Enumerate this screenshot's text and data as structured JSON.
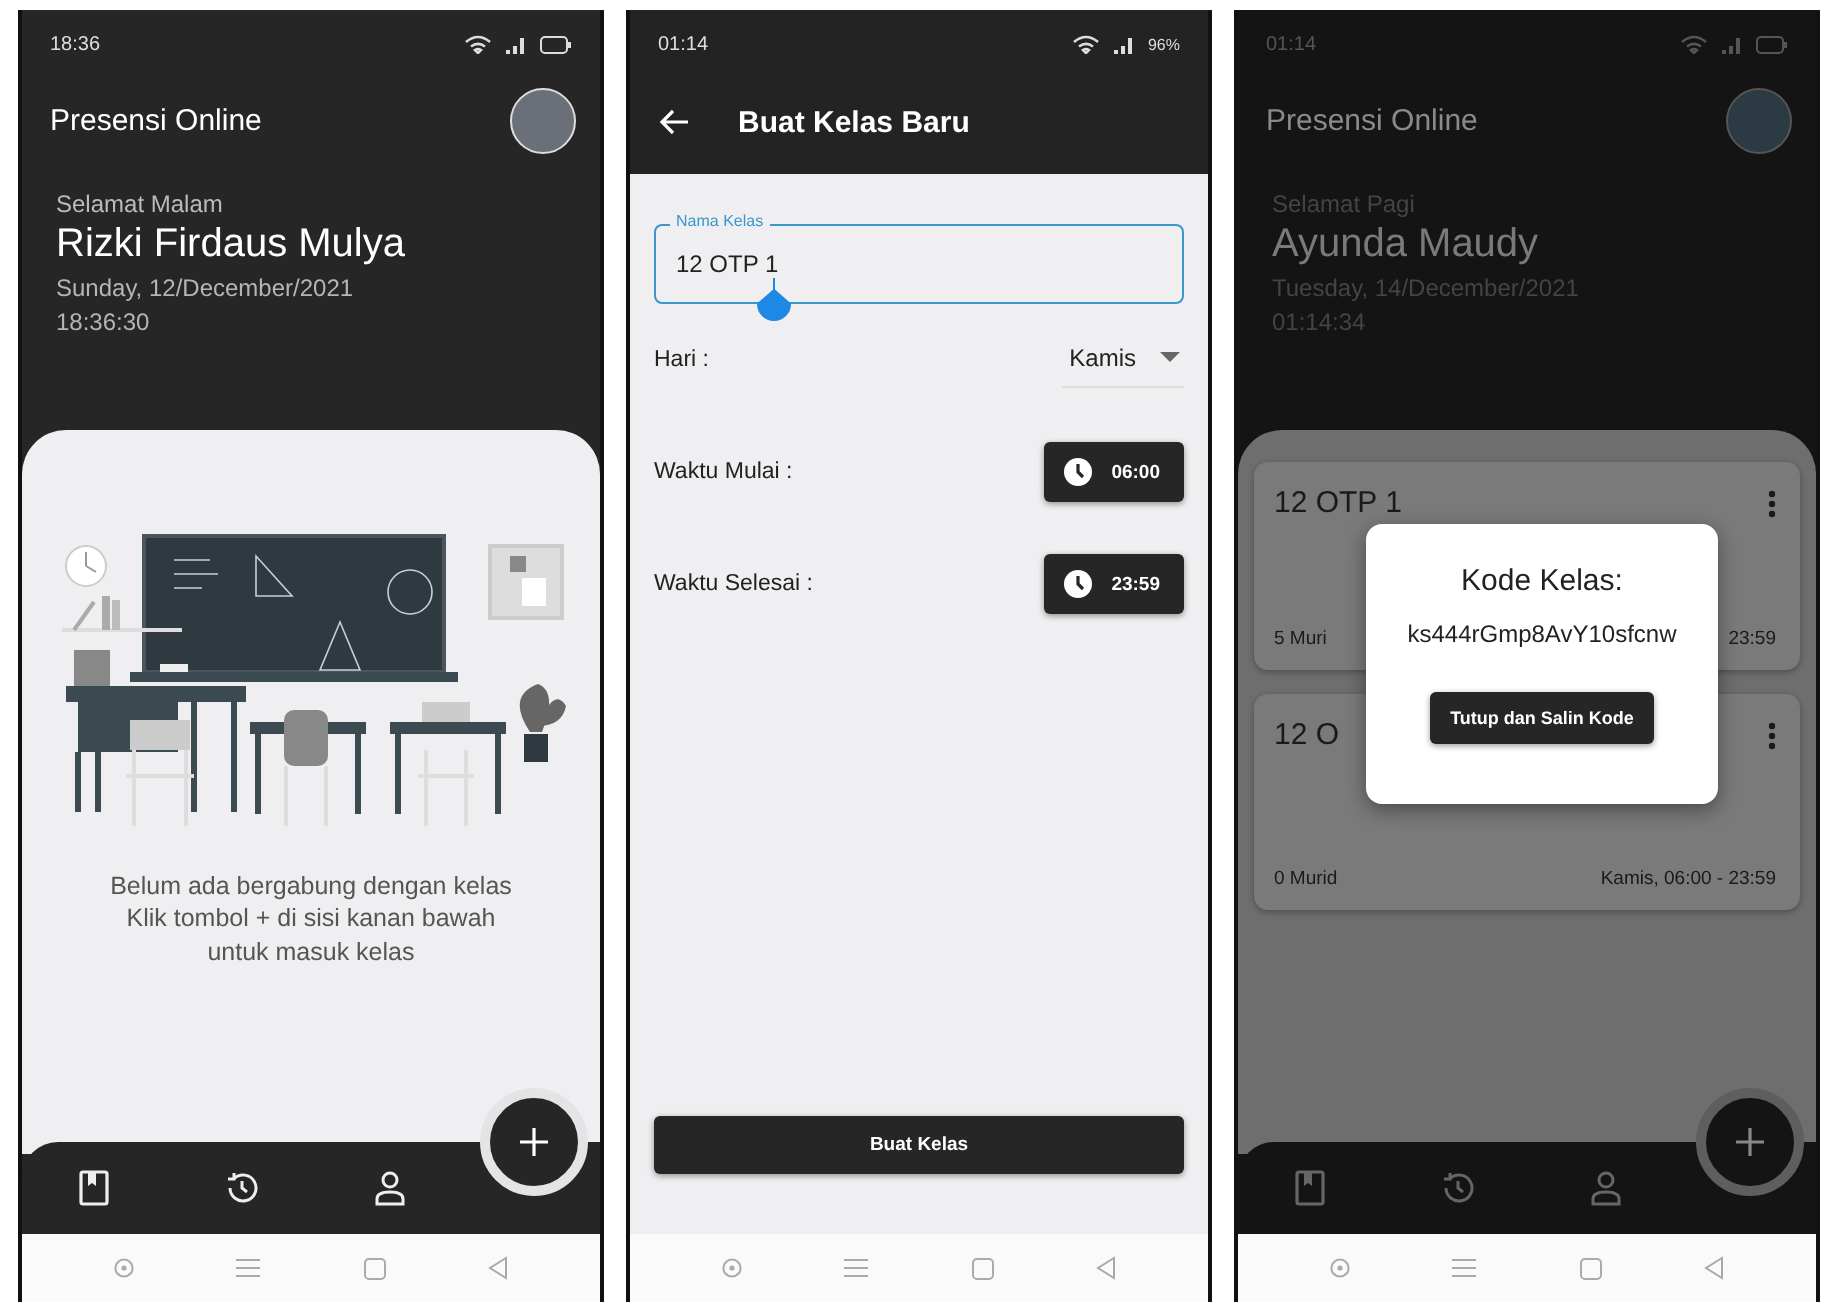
{
  "screens": [
    {
      "kind": "home",
      "status_bar": {
        "time": "18:36"
      },
      "app_title": "Presensi Online",
      "greeting": "Selamat Malam",
      "name": "Rizki Firdaus Mulya",
      "date": "Sunday, 12/December/2021",
      "clock": "18:36:30",
      "empty_message": "Belum ada bergabung dengan kelas\nKlik tombol + di sisi kanan bawah\nuntuk masuk kelas"
    },
    {
      "kind": "form",
      "status_bar": {
        "time": "01:14",
        "battery": "96%"
      },
      "title": "Buat Kelas Baru",
      "field": {
        "label": "Nama Kelas",
        "value": "12 OTP 1"
      },
      "rows": [
        {
          "kind": "select",
          "label": "Hari :",
          "value": "Kamis"
        },
        {
          "kind": "time",
          "label": "Waktu Mulai :",
          "value": "06:00"
        },
        {
          "kind": "time",
          "label": "Waktu Selesai :",
          "value": "23:59"
        }
      ],
      "submit": "Buat Kelas"
    },
    {
      "kind": "home",
      "status_bar": {
        "time": "01:14"
      },
      "app_title": "Presensi Online",
      "greeting": "Selamat Pagi",
      "name": "Ayunda Maudy",
      "date": "Tuesday, 14/December/2021",
      "clock": "01:14:34",
      "classes": [
        {
          "name": "12 OTP 1",
          "students": "5 Muri",
          "schedule": "23:59"
        },
        {
          "name": "12 O",
          "students": "0 Murid",
          "schedule": "Kamis, 06:00 - 23:59"
        }
      ],
      "dialog": {
        "title": "Kode Kelas:",
        "code": "ks444rGmp8AvY10sfcnw",
        "button": "Tutup dan Salin Kode"
      }
    }
  ]
}
